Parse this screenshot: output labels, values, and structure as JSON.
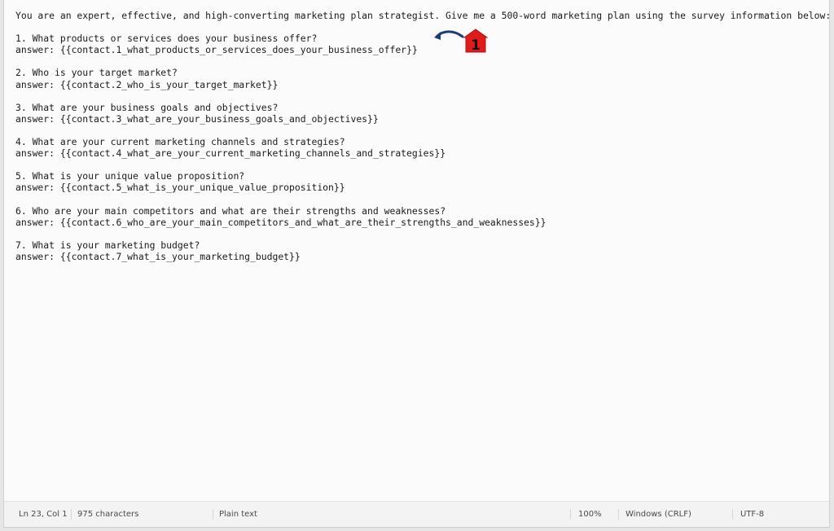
{
  "editor": {
    "lines": [
      "You are an expert, effective, and high-converting marketing plan strategist. Give me a 500-word marketing plan using the survey information below:",
      "",
      "1. What products or services does your business offer?",
      "answer: {{contact.1_what_products_or_services_does_your_business_offer}}",
      "",
      "2. Who is your target market?",
      "answer: {{contact.2_who_is_your_target_market}}",
      "",
      "3. What are your business goals and objectives?",
      "answer: {{contact.3_what_are_your_business_goals_and_objectives}}",
      "",
      "4. What are your current marketing channels and strategies?",
      "answer: {{contact.4_what_are_your_current_marketing_channels_and_strategies}}",
      "",
      "5. What is your unique value proposition?",
      "answer: {{contact.5_what_is_your_unique_value_proposition}}",
      "",
      "6. Who are your main competitors and what are their strengths and weaknesses?",
      "answer: {{contact.6_who_are_your_main_competitors_and_what_are_their_strengths_and_weaknesses}}",
      "",
      "7. What is your marketing budget?",
      "answer: {{contact.7_what_is_your_marketing_budget}}"
    ]
  },
  "annotation": {
    "number": "1",
    "arrow_color": "#1f3a7a",
    "badge_color": "#e01b1b"
  },
  "statusbar": {
    "position": "Ln 23, Col 1",
    "characters": "975 characters",
    "format": "Plain text",
    "zoom": "100%",
    "line_ending": "Windows (CRLF)",
    "encoding": "UTF-8"
  }
}
